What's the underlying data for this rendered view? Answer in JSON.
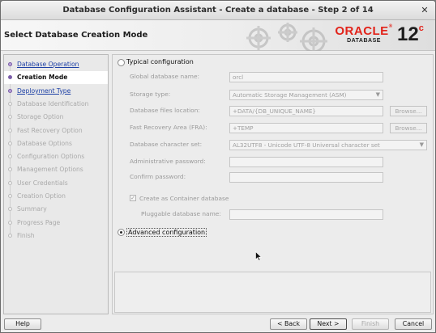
{
  "window": {
    "title": "Database Configuration Assistant - Create a database - Step 2 of 14",
    "close_glyph": "✕"
  },
  "banner": {
    "heading": "Select Database Creation Mode",
    "logo_oracle": "ORACLE",
    "logo_reg": "®",
    "logo_database": "DATABASE",
    "version": "12",
    "version_sup": "c"
  },
  "steps": [
    {
      "label": "Database Operation",
      "state": "done"
    },
    {
      "label": "Creation Mode",
      "state": "current"
    },
    {
      "label": "Deployment Type",
      "state": "done"
    },
    {
      "label": "Database Identification",
      "state": "pending"
    },
    {
      "label": "Storage Option",
      "state": "pending"
    },
    {
      "label": "Fast Recovery Option",
      "state": "pending"
    },
    {
      "label": "Database Options",
      "state": "pending"
    },
    {
      "label": "Configuration Options",
      "state": "pending"
    },
    {
      "label": "Management Options",
      "state": "pending"
    },
    {
      "label": "User Credentials",
      "state": "pending"
    },
    {
      "label": "Creation Option",
      "state": "pending"
    },
    {
      "label": "Summary",
      "state": "pending"
    },
    {
      "label": "Progress Page",
      "state": "pending"
    },
    {
      "label": "Finish",
      "state": "pending"
    }
  ],
  "mode": {
    "typical_label": "Typical configuration",
    "typical_selected": false,
    "advanced_label": "Advanced configuration",
    "advanced_selected": true
  },
  "form": {
    "global_db_name_label": "Global database name:",
    "global_db_name_value": "orcl",
    "storage_type_label": "Storage type:",
    "storage_type_value": "Automatic Storage Management (ASM)",
    "db_files_location_label": "Database files location:",
    "db_files_location_value": "+DATA/{DB_UNIQUE_NAME}",
    "fra_label": "Fast Recovery Area (FRA):",
    "fra_value": "+TEMP",
    "charset_label": "Database character set:",
    "charset_value": "AL32UTF8 - Unicode UTF-8 Universal character set",
    "admin_password_label": "Administrative password:",
    "admin_password_value": "",
    "confirm_password_label": "Confirm password:",
    "confirm_password_value": "",
    "container_label": "Create as Container database",
    "container_checked": true,
    "pluggable_label": "Pluggable database name:",
    "pluggable_value": "",
    "browse_label": "Browse..."
  },
  "footer": {
    "help": "Help",
    "back": "< Back",
    "next": "Next >",
    "finish": "Finish",
    "cancel": "Cancel"
  },
  "icons": {
    "close": "close-icon",
    "dropdown": "chevron-down-icon",
    "checkbox": "check-icon",
    "cursor": "mouse-pointer-icon"
  },
  "colors": {
    "oracle_red": "#e2231a",
    "step_link": "#1c3fa5",
    "step_marker": "#7b5da8"
  }
}
